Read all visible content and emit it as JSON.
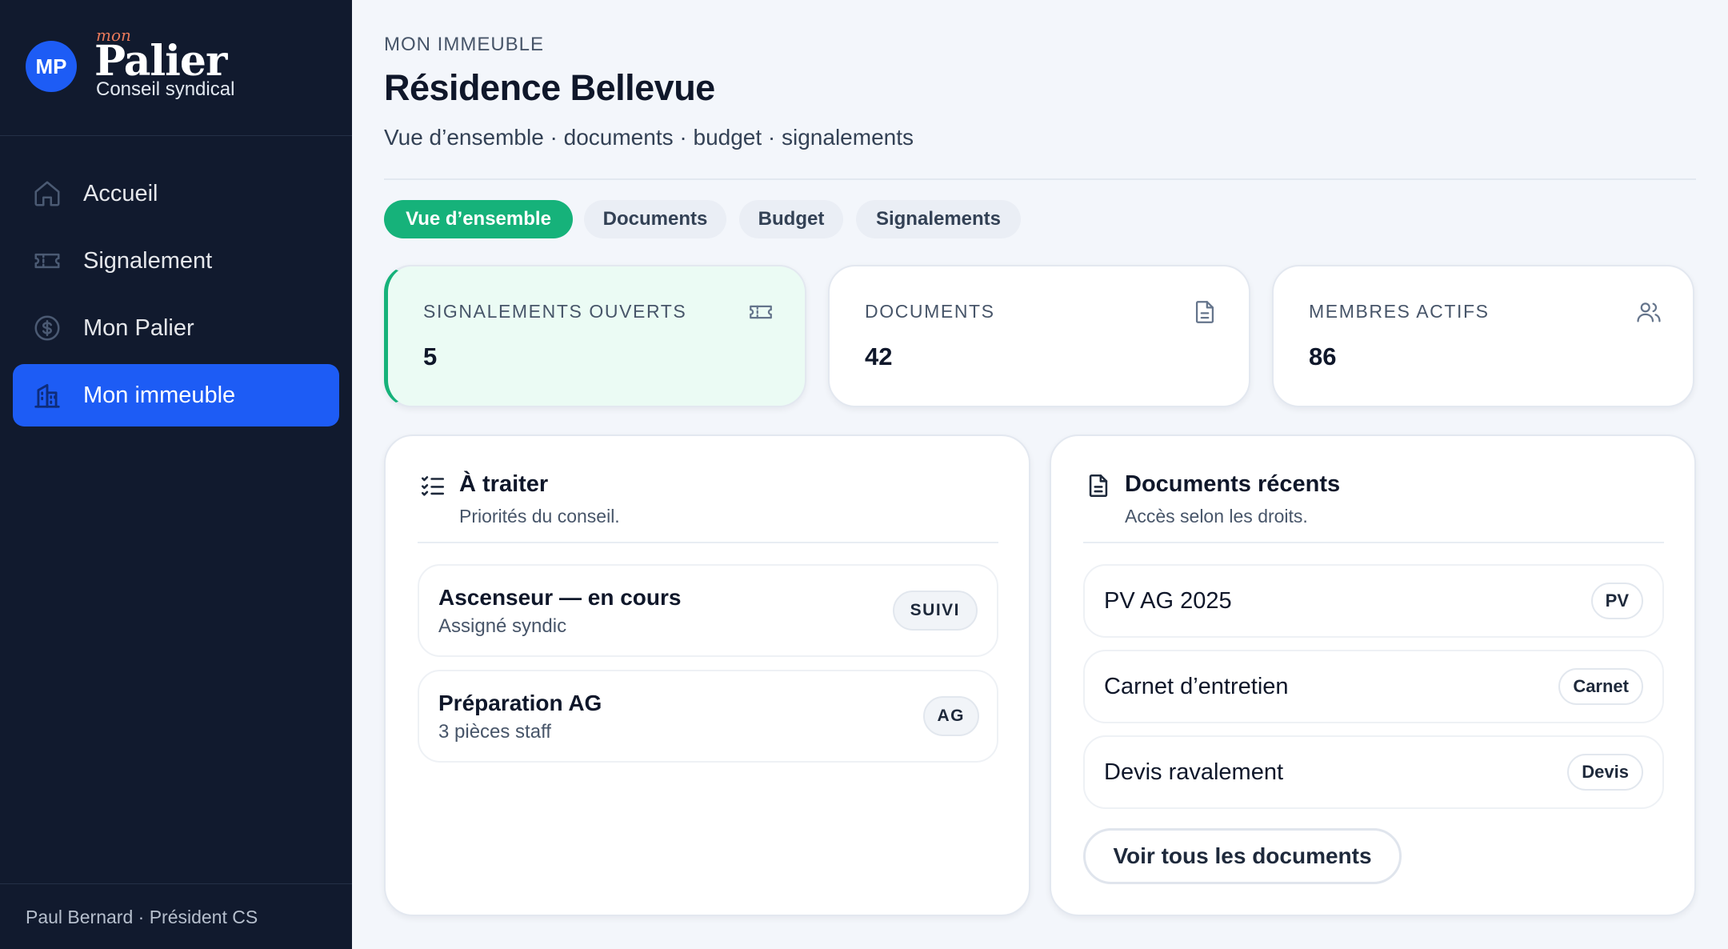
{
  "brand": {
    "avatar": "MP",
    "prefix": "mon",
    "name": "Palier",
    "subtitle": "Conseil syndical"
  },
  "sidebar": {
    "items": [
      {
        "label": "Accueil",
        "icon": "home-icon",
        "active": false
      },
      {
        "label": "Signalement",
        "icon": "ticket-icon",
        "active": false
      },
      {
        "label": "Mon Palier",
        "icon": "dollar-icon",
        "active": false
      },
      {
        "label": "Mon immeuble",
        "icon": "building-icon",
        "active": true
      }
    ],
    "footer": "Paul Bernard · Président CS"
  },
  "header": {
    "eyebrow": "MON IMMEUBLE",
    "title": "Résidence Bellevue",
    "subtitle": "Vue d’ensemble · documents · budget · signalements"
  },
  "tabs": [
    {
      "label": "Vue d’ensemble",
      "active": true
    },
    {
      "label": "Documents",
      "active": false
    },
    {
      "label": "Budget",
      "active": false
    },
    {
      "label": "Signalements",
      "active": false
    }
  ],
  "stats": [
    {
      "label": "SIGNALEMENTS OUVERTS",
      "value": "5",
      "icon": "ticket-icon"
    },
    {
      "label": "DOCUMENTS",
      "value": "42",
      "icon": "document-icon"
    },
    {
      "label": "MEMBRES ACTIFS",
      "value": "86",
      "icon": "users-icon"
    }
  ],
  "todo": {
    "title": "À traiter",
    "subtitle": "Priorités du conseil.",
    "icon": "checklist-icon",
    "items": [
      {
        "title": "Ascenseur — en cours",
        "subtitle": "Assigné syndic",
        "badge": "SUIVI"
      },
      {
        "title": "Préparation AG",
        "subtitle": "3 pièces staff",
        "badge": "AG"
      }
    ]
  },
  "documents": {
    "title": "Documents récents",
    "subtitle": "Accès selon les droits.",
    "icon": "document-icon",
    "items": [
      {
        "title": "PV AG 2025",
        "badge": "PV"
      },
      {
        "title": "Carnet d’entretien",
        "badge": "Carnet"
      },
      {
        "title": "Devis ravalement",
        "badge": "Devis"
      }
    ],
    "button": "Voir tous les documents"
  },
  "colors": {
    "sidebar_bg": "#111a2e",
    "accent_blue": "#1d5cf5",
    "accent_green": "#16b27a",
    "brand_prefix": "#e8795a"
  }
}
